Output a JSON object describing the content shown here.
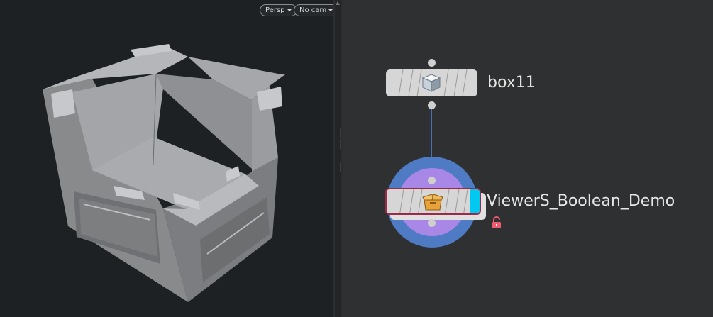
{
  "viewport": {
    "persp_label": "Persp",
    "cam_label": "No cam"
  },
  "network": {
    "nodes": [
      {
        "name": "box11",
        "icon": "cube-icon"
      },
      {
        "name": "ViewerS_Boolean_Demo",
        "icon": "package-icon",
        "flags": [
          "display",
          "render"
        ],
        "unlocked": true
      }
    ]
  },
  "colors": {
    "viewport_bg": "#1e2124",
    "network_bg": "#2f3031",
    "node_body": "#d6d6d6",
    "display_flag_blue": "#00c8f0",
    "ring_outer": "#4f7ac4",
    "ring_inner": "#a887e6",
    "unlock_red": "#f05a6e"
  }
}
